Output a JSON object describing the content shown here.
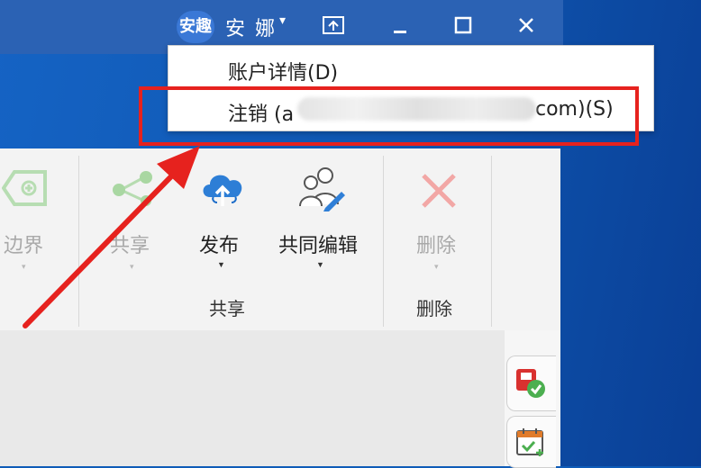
{
  "titlebar": {
    "avatar_text": "安趣",
    "user_name": "安 娜",
    "caret": "▾"
  },
  "menu": {
    "items": [
      {
        "label": "账户详情(D)"
      },
      {
        "label": "注销 (a",
        "label_suffix": "com)(S)"
      }
    ]
  },
  "ribbon": {
    "buttons": [
      {
        "label": "边界",
        "enabled": false
      },
      {
        "label": "共享",
        "enabled": false
      },
      {
        "label": "发布",
        "enabled": true
      },
      {
        "label": "共同编辑",
        "enabled": true
      },
      {
        "label": "删除",
        "enabled": false
      }
    ],
    "groups": [
      {
        "label": "共享"
      },
      {
        "label": "删除"
      }
    ]
  },
  "colors": {
    "titlebar": "#2b62b4",
    "desktop": "#1563c4",
    "highlight": "#e6221e",
    "ribbon": "#f3f3f3"
  },
  "icons": [
    "boundary-icon",
    "share-icon",
    "publish-cloud-icon",
    "coedit-icon",
    "delete-icon",
    "minimize-icon",
    "maximize-icon",
    "close-icon",
    "pin-icon",
    "task-icon",
    "calendar-icon"
  ]
}
